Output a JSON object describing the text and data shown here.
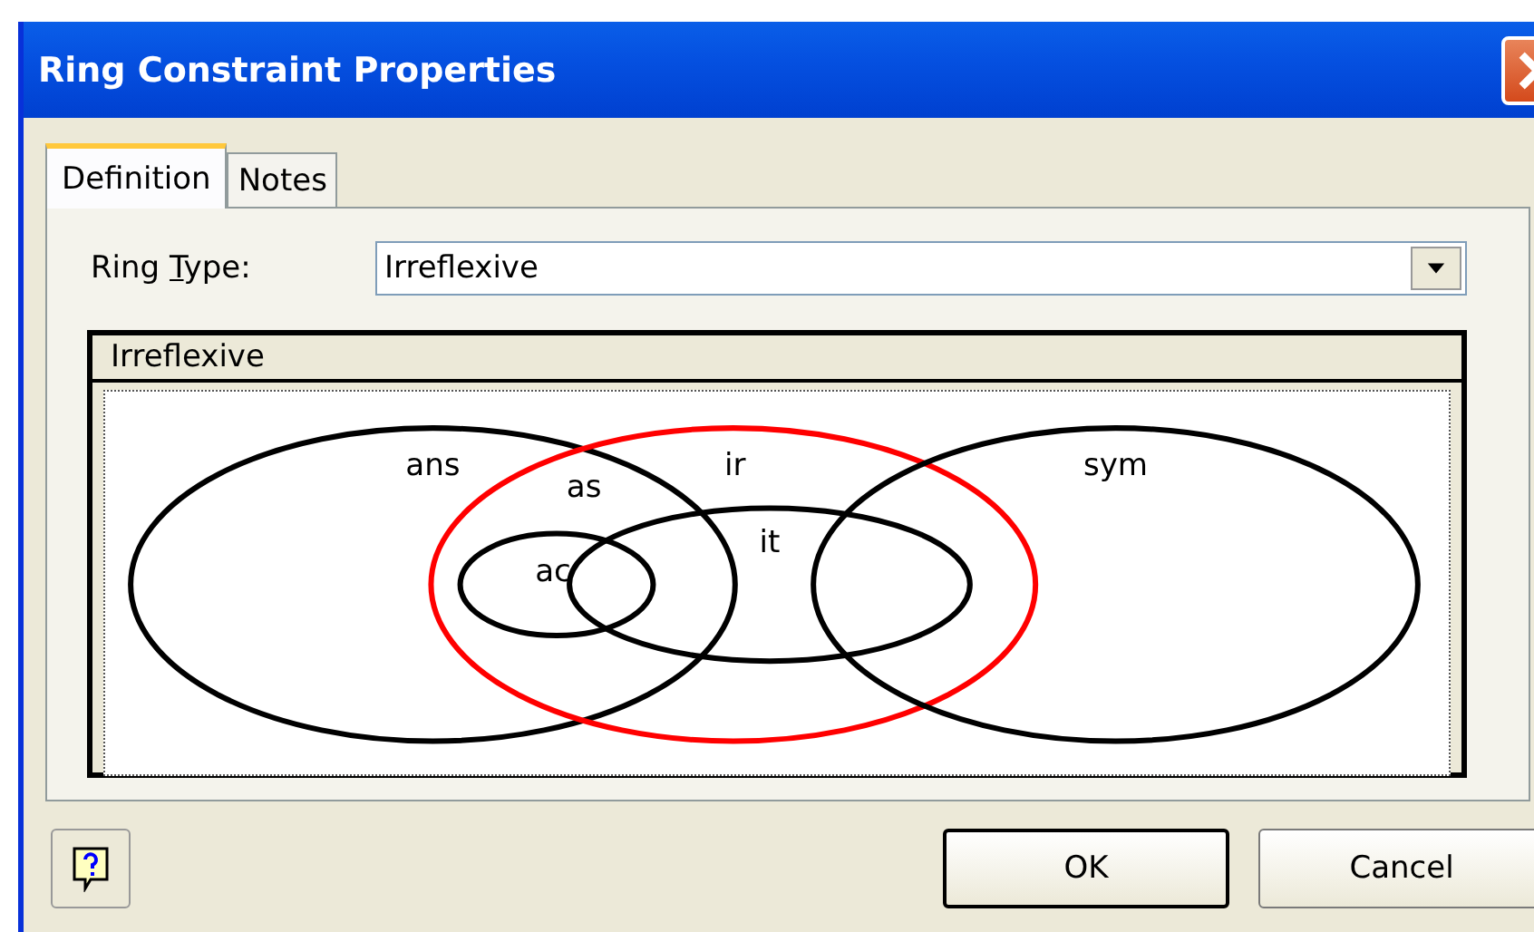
{
  "window": {
    "title": "Ring Constraint Properties"
  },
  "tabs": [
    {
      "label": "Definition",
      "selected": true
    },
    {
      "label": "Notes",
      "selected": false
    }
  ],
  "ring_type": {
    "label_start": "Ring ",
    "accelerator": "T",
    "label_end": "ype:",
    "value": "Irreflexive"
  },
  "diagram": {
    "title": "Irreflexive",
    "sets": [
      {
        "label": "ans",
        "color": "#000000"
      },
      {
        "label": "ir",
        "color": "#ff0000"
      },
      {
        "label": "sym",
        "color": "#000000"
      },
      {
        "label": "it",
        "color": "#000000"
      },
      {
        "label": "ac",
        "color": "#000000"
      }
    ],
    "region_labels": [
      "as"
    ]
  },
  "buttons": [
    {
      "label": "OK",
      "default": true
    },
    {
      "label": "Cancel",
      "default": false
    }
  ]
}
